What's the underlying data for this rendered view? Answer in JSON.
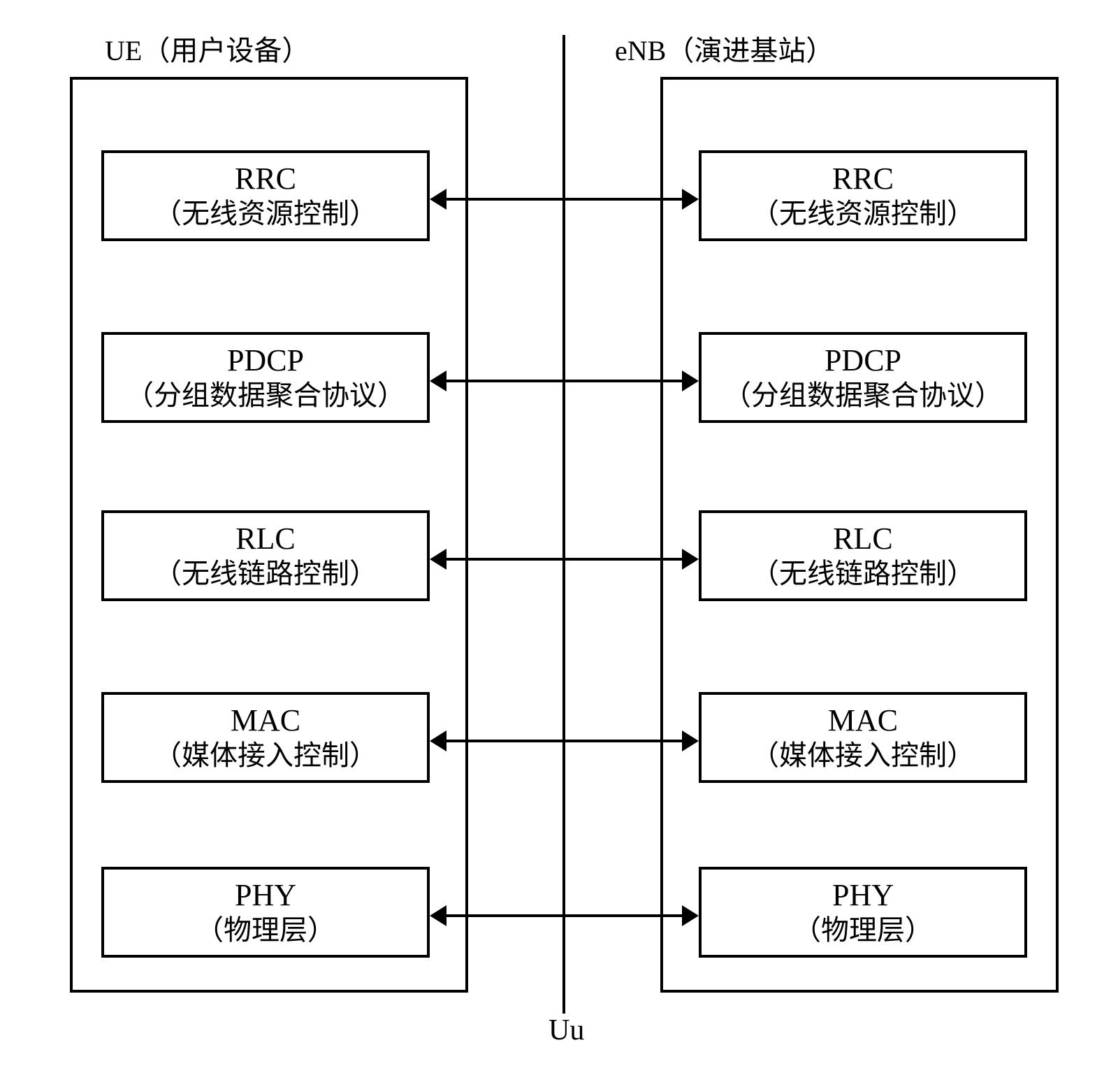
{
  "ue": {
    "title": "UE（用户设备）",
    "layers": [
      {
        "abbr": "RRC",
        "desc": "（无线资源控制）"
      },
      {
        "abbr": "PDCP",
        "desc": "（分组数据聚合协议）"
      },
      {
        "abbr": "RLC",
        "desc": "（无线链路控制）"
      },
      {
        "abbr": "MAC",
        "desc": "（媒体接入控制）"
      },
      {
        "abbr": "PHY",
        "desc": "（物理层）"
      }
    ]
  },
  "enb": {
    "title": "eNB（演进基站）",
    "layers": [
      {
        "abbr": "RRC",
        "desc": "（无线资源控制）"
      },
      {
        "abbr": "PDCP",
        "desc": "（分组数据聚合协议）"
      },
      {
        "abbr": "RLC",
        "desc": "（无线链路控制）"
      },
      {
        "abbr": "MAC",
        "desc": "（媒体接入控制）"
      },
      {
        "abbr": "PHY",
        "desc": "（物理层）"
      }
    ]
  },
  "interface_label": "Uu"
}
